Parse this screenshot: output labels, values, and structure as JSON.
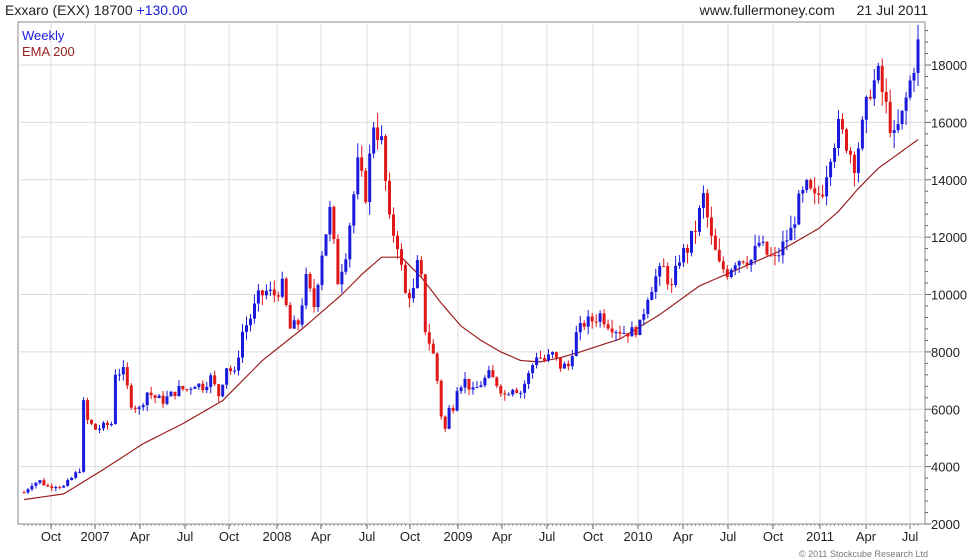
{
  "header": {
    "ticker": "Exxaro (EXX) 18700",
    "change": "+130.00",
    "source": "www.fullermoney.com",
    "date": "21 Jul 2011"
  },
  "footer": {
    "copyright": "© 2011 Stockcube Research Ltd"
  },
  "colors": {
    "up": "#1a1adb",
    "down": "#e01818",
    "ema": "#9b2020",
    "grid": "#dcdcdc",
    "axis": "#666666"
  },
  "chart_data": {
    "type": "line",
    "title": "Exxaro (EXX) 18700 +130.00",
    "interval": "Weekly",
    "legend": [
      "Weekly",
      "EMA 200"
    ],
    "legend_position": "top-left",
    "grid": true,
    "y_axis_side": "right",
    "ylim": [
      2000,
      19500
    ],
    "y_ticks": [
      2000,
      4000,
      6000,
      8000,
      10000,
      12000,
      14000,
      16000,
      18000
    ],
    "x_ticks": [
      "Oct",
      "2007",
      "Apr",
      "Jul",
      "Oct",
      "2008",
      "Apr",
      "Jul",
      "Oct",
      "2009",
      "Apr",
      "Jul",
      "Oct",
      "2010",
      "Apr",
      "Jul",
      "Oct",
      "2011",
      "Apr",
      "Jul"
    ],
    "price_anchors": [
      [
        0,
        3100
      ],
      [
        2,
        3400
      ],
      [
        4,
        3500
      ],
      [
        6,
        3300
      ],
      [
        8,
        3350
      ],
      [
        10,
        3300
      ],
      [
        12,
        3600
      ],
      [
        14,
        3900
      ],
      [
        15,
        6200
      ],
      [
        16,
        5600
      ],
      [
        18,
        5300
      ],
      [
        20,
        5400
      ],
      [
        22,
        5500
      ],
      [
        23,
        7300
      ],
      [
        25,
        7300
      ],
      [
        27,
        6200
      ],
      [
        29,
        6000
      ],
      [
        31,
        6600
      ],
      [
        33,
        6400
      ],
      [
        35,
        6300
      ],
      [
        37,
        6500
      ],
      [
        39,
        6700
      ],
      [
        41,
        6700
      ],
      [
        43,
        6900
      ],
      [
        45,
        6800
      ],
      [
        47,
        7100
      ],
      [
        49,
        6500
      ],
      [
        51,
        7500
      ],
      [
        53,
        7200
      ],
      [
        55,
        8700
      ],
      [
        57,
        9200
      ],
      [
        59,
        9900
      ],
      [
        61,
        10100
      ],
      [
        63,
        10000
      ],
      [
        65,
        10300
      ],
      [
        67,
        8800
      ],
      [
        69,
        9000
      ],
      [
        71,
        10500
      ],
      [
        73,
        9600
      ],
      [
        75,
        11500
      ],
      [
        77,
        12900
      ],
      [
        79,
        10500
      ],
      [
        81,
        11500
      ],
      [
        83,
        13500
      ],
      [
        84,
        14500
      ],
      [
        86,
        13500
      ],
      [
        88,
        16000
      ],
      [
        90,
        15300
      ],
      [
        92,
        12500
      ],
      [
        94,
        11800
      ],
      [
        96,
        10000
      ],
      [
        98,
        10100
      ],
      [
        99,
        11000
      ],
      [
        100,
        10500
      ],
      [
        101,
        8800
      ],
      [
        103,
        7900
      ],
      [
        104,
        7000
      ],
      [
        105,
        5800
      ],
      [
        106,
        5300
      ],
      [
        107,
        6000
      ],
      [
        108,
        6100
      ],
      [
        109,
        6800
      ],
      [
        111,
        7000
      ],
      [
        113,
        6600
      ],
      [
        115,
        6900
      ],
      [
        117,
        7200
      ],
      [
        119,
        6900
      ],
      [
        121,
        6500
      ],
      [
        123,
        6800
      ],
      [
        125,
        6600
      ],
      [
        127,
        7200
      ],
      [
        129,
        7900
      ],
      [
        131,
        7700
      ],
      [
        133,
        7900
      ],
      [
        135,
        7500
      ],
      [
        137,
        7500
      ],
      [
        139,
        8600
      ],
      [
        141,
        9000
      ],
      [
        143,
        9100
      ],
      [
        145,
        9300
      ],
      [
        147,
        9000
      ],
      [
        149,
        8800
      ],
      [
        151,
        8700
      ],
      [
        153,
        8700
      ],
      [
        155,
        8900
      ],
      [
        157,
        10000
      ],
      [
        159,
        10600
      ],
      [
        161,
        10900
      ],
      [
        163,
        10200
      ],
      [
        165,
        11300
      ],
      [
        167,
        11600
      ],
      [
        169,
        12300
      ],
      [
        171,
        13400
      ],
      [
        173,
        11900
      ],
      [
        175,
        11000
      ],
      [
        177,
        10800
      ],
      [
        179,
        11200
      ],
      [
        181,
        11300
      ],
      [
        183,
        11200
      ],
      [
        185,
        11800
      ],
      [
        187,
        11400
      ],
      [
        189,
        11200
      ],
      [
        191,
        11700
      ],
      [
        193,
        12200
      ],
      [
        195,
        13200
      ],
      [
        197,
        13700
      ],
      [
        199,
        13300
      ],
      [
        201,
        13700
      ],
      [
        203,
        15000
      ],
      [
        205,
        15800
      ],
      [
        207,
        15300
      ],
      [
        209,
        14600
      ],
      [
        211,
        15800
      ],
      [
        213,
        17200
      ],
      [
        215,
        17600
      ],
      [
        217,
        16500
      ],
      [
        219,
        15400
      ],
      [
        221,
        16200
      ],
      [
        223,
        17400
      ],
      [
        225,
        18700
      ]
    ],
    "ema_200": [
      [
        0,
        2850
      ],
      [
        10,
        3050
      ],
      [
        20,
        3900
      ],
      [
        30,
        4800
      ],
      [
        40,
        5500
      ],
      [
        50,
        6300
      ],
      [
        60,
        7700
      ],
      [
        70,
        8800
      ],
      [
        80,
        10000
      ],
      [
        85,
        10700
      ],
      [
        90,
        11300
      ],
      [
        95,
        11300
      ],
      [
        100,
        10600
      ],
      [
        105,
        9700
      ],
      [
        110,
        8900
      ],
      [
        115,
        8400
      ],
      [
        120,
        8000
      ],
      [
        125,
        7700
      ],
      [
        130,
        7650
      ],
      [
        135,
        7800
      ],
      [
        140,
        8000
      ],
      [
        150,
        8450
      ],
      [
        160,
        9300
      ],
      [
        170,
        10300
      ],
      [
        180,
        10900
      ],
      [
        190,
        11500
      ],
      [
        200,
        12300
      ],
      [
        205,
        12900
      ],
      [
        210,
        13700
      ],
      [
        215,
        14400
      ],
      [
        220,
        14900
      ],
      [
        225,
        15400
      ]
    ]
  }
}
